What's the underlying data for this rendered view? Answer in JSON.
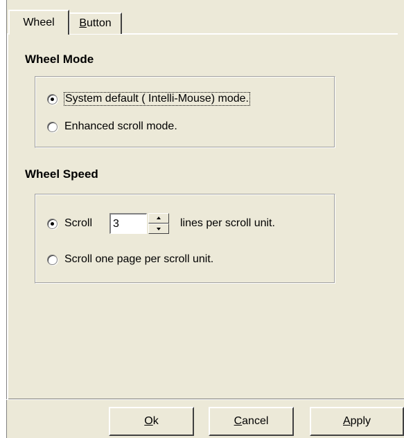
{
  "tabs": [
    {
      "label": "Wheel",
      "selected": true
    },
    {
      "label": "Button",
      "accel": "B",
      "rest": "utton",
      "selected": false
    }
  ],
  "wheel_mode": {
    "heading": "Wheel Mode",
    "options": [
      {
        "label": "System default ( Intelli-Mouse) mode.",
        "checked": true
      },
      {
        "label": "Enhanced scroll mode.",
        "checked": false
      }
    ]
  },
  "wheel_speed": {
    "heading": "Wheel Speed",
    "scroll_label": "Scroll",
    "lines_value": "3",
    "unit_text": "lines per scroll unit.",
    "page_option": "Scroll one page per scroll unit.",
    "scroll_lines_checked": true
  },
  "buttons": {
    "ok_accel": "O",
    "ok_rest": "k",
    "cancel_accel": "C",
    "cancel_rest": "ancel",
    "apply_accel": "A",
    "apply_rest": "pply"
  }
}
